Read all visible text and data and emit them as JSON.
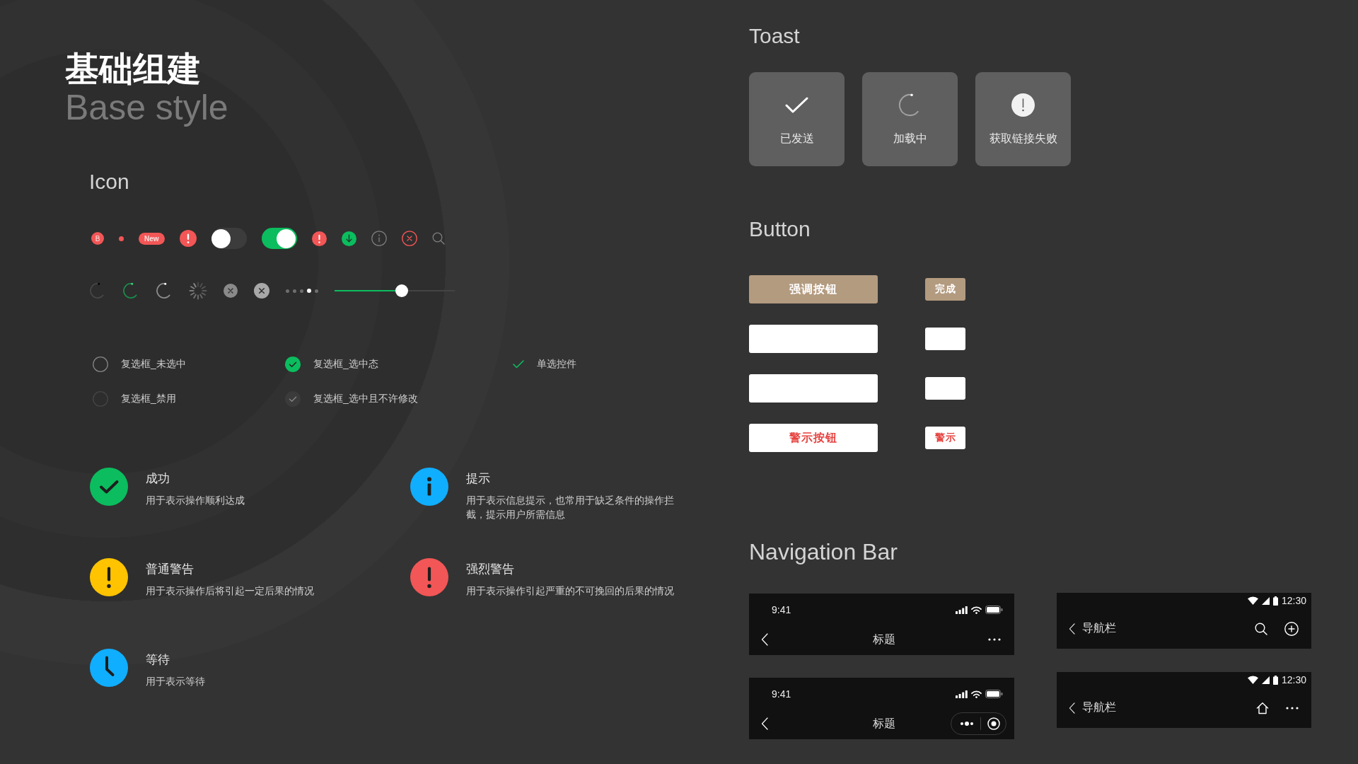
{
  "header": {
    "title": "基础组建",
    "subtitle": "Base style"
  },
  "icon_section": {
    "heading": "Icon",
    "row_1": [
      {
        "kind": "count_badge",
        "text": "B"
      },
      {
        "kind": "dot_badge"
      },
      {
        "kind": "text_badge",
        "text": "New"
      },
      {
        "kind": "alert"
      },
      {
        "kind": "switch",
        "on": false
      },
      {
        "kind": "switch",
        "on": true
      },
      {
        "kind": "alert_small"
      },
      {
        "kind": "download"
      },
      {
        "kind": "info"
      },
      {
        "kind": "error"
      },
      {
        "kind": "search"
      }
    ],
    "row_2": [
      {
        "kind": "spinner_dark"
      },
      {
        "kind": "spinner_green"
      },
      {
        "kind": "spinner_light"
      },
      {
        "kind": "tick_spinner"
      },
      {
        "kind": "clear_dark"
      },
      {
        "kind": "clear_light"
      },
      {
        "kind": "page_dots",
        "dots": [
          {
            "selected": false
          },
          {
            "selected": false
          },
          {
            "selected": false
          },
          {
            "selected": true
          },
          {
            "selected": false
          }
        ]
      },
      {
        "kind": "slider",
        "level": 0.56
      }
    ]
  },
  "checkboxes": [
    {
      "kind": "checkbox",
      "label": "复选框_未选中",
      "checked": false,
      "disabled": false
    },
    {
      "kind": "checkbox",
      "label": "复选框_选中态",
      "checked": true,
      "disabled": false
    },
    {
      "kind": "radio",
      "label": "单选控件",
      "checked": true
    },
    {
      "kind": "checkbox",
      "label": "复选框_禁用",
      "checked": false,
      "disabled": true
    },
    {
      "kind": "checkbox",
      "label": "复选框_选中且不许修改",
      "checked": true,
      "disabled": true
    }
  ],
  "status_icons": [
    {
      "kind": "success",
      "title": "成功",
      "description": "用于表示操作顺利达成"
    },
    {
      "kind": "info",
      "title": "提示",
      "description": "用于表示信息提示，也常用于缺乏条件的操作拦截，提示用户所需信息"
    },
    {
      "kind": "warning",
      "title": "普通警告",
      "description": "用于表示操作后将引起一定后果的情况"
    },
    {
      "kind": "danger",
      "title": "强烈警告",
      "description": "用于表示操作引起严重的不可挽回的后果的情况"
    },
    {
      "kind": "waiting",
      "title": "等待",
      "description": "用于表示等待"
    }
  ],
  "toast": {
    "heading": "Toast",
    "items": [
      {
        "kind": "success",
        "text": "已发送"
      },
      {
        "kind": "loading",
        "text": "加载中"
      },
      {
        "kind": "error",
        "text": "获取链接失败"
      }
    ]
  },
  "button_section": {
    "heading": "Button",
    "rows": [
      {
        "kind": "primary",
        "labels": [
          "强调按钮",
          "完成"
        ]
      },
      {
        "kind": "default"
      },
      {
        "kind": "default"
      },
      {
        "kind": "warn",
        "labels": [
          "警示按钮",
          "警示"
        ]
      }
    ]
  },
  "navigation": {
    "heading": "Navigation Bar",
    "bars": [
      {
        "kind": "ios",
        "time": "9:41",
        "title": "标题",
        "actions": [
          {
            "kind": "more"
          }
        ]
      },
      {
        "kind": "android",
        "time": "12:30",
        "title": "导航栏",
        "actions": [
          {
            "kind": "search"
          },
          {
            "kind": "add"
          }
        ]
      },
      {
        "kind": "ios",
        "time": "9:41",
        "title": "标题",
        "actions": [
          {
            "kind": "capsule"
          }
        ]
      },
      {
        "kind": "android",
        "time": "12:30",
        "title": "导航栏",
        "actions": [
          {
            "kind": "home"
          },
          {
            "kind": "more"
          }
        ]
      }
    ]
  }
}
